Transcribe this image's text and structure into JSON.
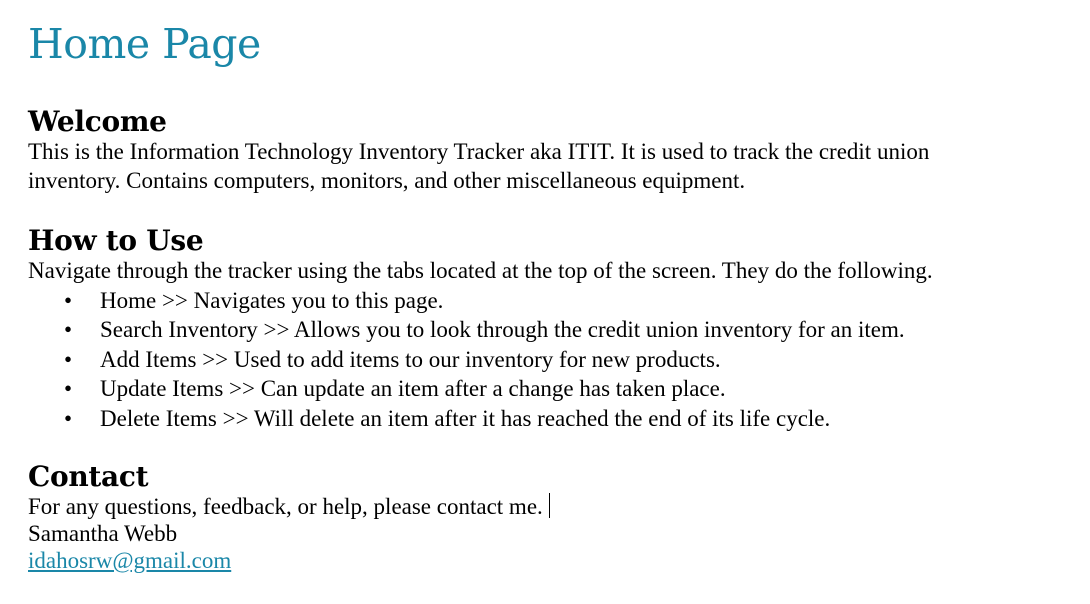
{
  "page": {
    "title": "Home Page"
  },
  "welcome": {
    "heading": "Welcome",
    "line1": "This is the Information Technology Inventory Tracker aka ITIT. It is used to track the credit union",
    "line2": "inventory. Contains computers, monitors, and other miscellaneous equipment."
  },
  "how_to_use": {
    "heading": "How to Use",
    "intro": "Navigate through the tracker using the tabs located at the top of the screen. They do the following.",
    "items": [
      {
        "bullet": "•",
        "text": "Home >> Navigates you to this page."
      },
      {
        "bullet": "•",
        "text": "Search Inventory >> Allows you to look through the credit union inventory for an item."
      },
      {
        "bullet": "•",
        "text": "Add Items >> Used to add items to our inventory for new products."
      },
      {
        "bullet": "•",
        "text": "Update Items >> Can update an item after a change has taken place."
      },
      {
        "bullet": "•",
        "text": "Delete Items >> Will delete an item after it has reached the end of its life cycle."
      }
    ]
  },
  "contact": {
    "heading": "Contact",
    "message": "For any questions, feedback, or help, please contact me.",
    "name": "Samantha Webb",
    "email": "idahosrw@gmail.com"
  },
  "colors": {
    "title": "#1a87a8",
    "link": "#1a87a8",
    "text": "#000000"
  }
}
